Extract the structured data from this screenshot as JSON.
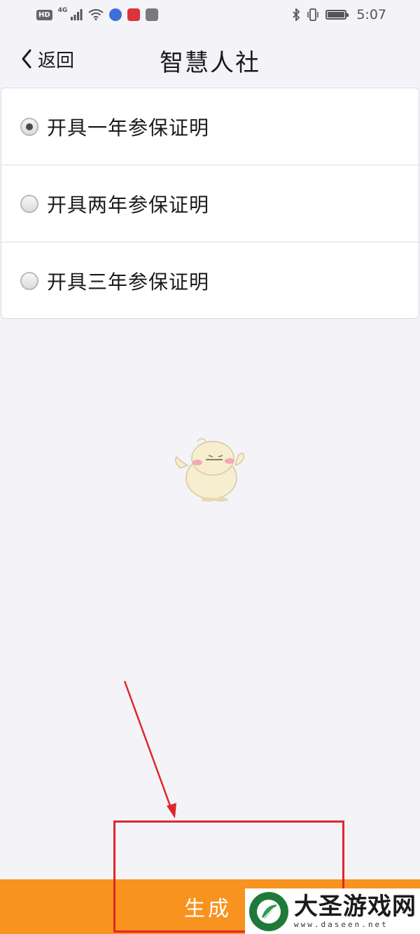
{
  "status_bar": {
    "hd": "HD",
    "network": "4G",
    "time": "5:07"
  },
  "nav": {
    "back_label": "返回",
    "title": "智慧人社"
  },
  "options": [
    {
      "label": "开具一年参保证明",
      "checked": true
    },
    {
      "label": "开具两年参保证明",
      "checked": false
    },
    {
      "label": "开具三年参保证明",
      "checked": false
    }
  ],
  "bottom": {
    "generate_label": "生成",
    "button_color": "#f7931e"
  },
  "watermark": {
    "name": "大圣游戏网",
    "url": "www.daseen.net"
  },
  "annotation_color": "#e0262b"
}
